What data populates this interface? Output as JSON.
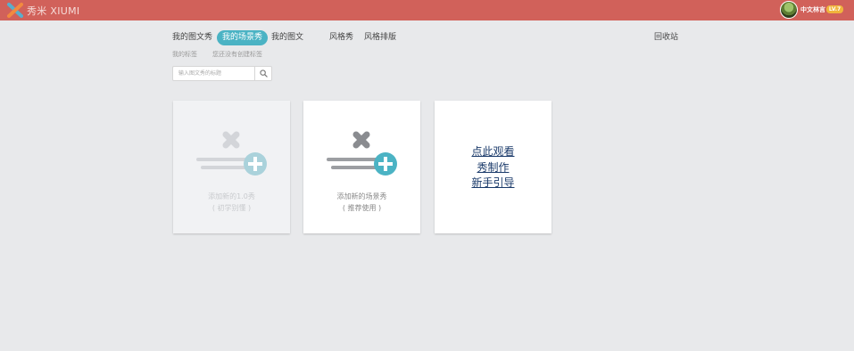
{
  "header": {
    "logo_text": "秀米 XIUMI",
    "user_name": "中文林言",
    "level": "LV.7",
    "colors": {
      "bar": "#d1615a",
      "badge": "#f0b43c"
    }
  },
  "tabs": [
    {
      "label": "我的图文秀"
    },
    {
      "label": "我的场景秀"
    },
    {
      "label": "我的图文"
    },
    {
      "label": "风格秀"
    },
    {
      "label": "风格排版"
    },
    {
      "label": "回收站"
    }
  ],
  "subheader": {
    "tags_label": "我的标签",
    "no_tags_hint": "您还没有创建标签"
  },
  "search": {
    "placeholder": "输入图文秀的标题",
    "icon": "search-icon"
  },
  "cards": [
    {
      "label_1": "添加新的1.0秀",
      "label_2": "( 初学别懂 )",
      "state": "disabled"
    },
    {
      "label_1": "添加新的场景秀",
      "label_2": "( 推荐使用 )",
      "state": "enabled"
    },
    {
      "link_1": "点此观看",
      "link_2": "秀制作",
      "link_3": "新手引导"
    }
  ],
  "accent_color": "#4bb3c4"
}
